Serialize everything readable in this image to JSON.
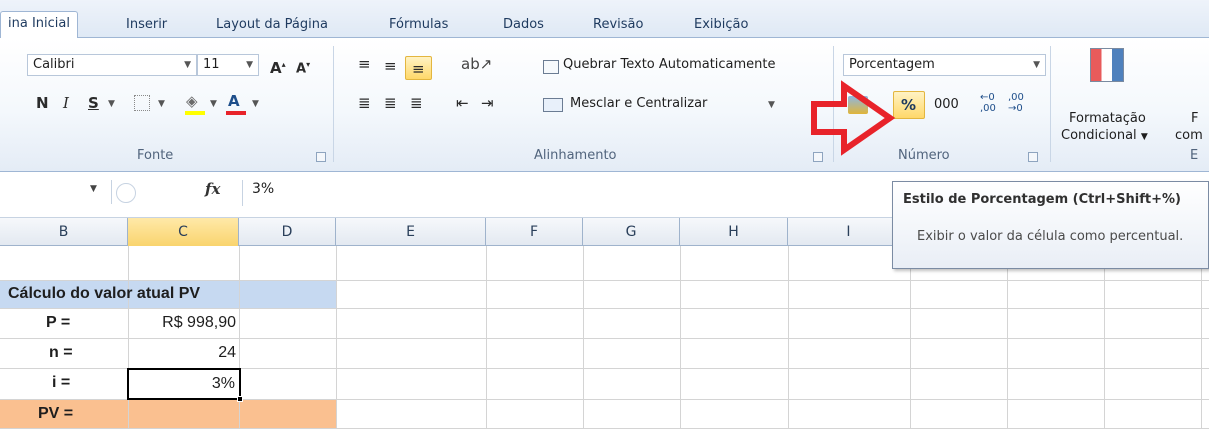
{
  "tabs": [
    "ina Inicial",
    "Inserir",
    "Layout da Página",
    "Fórmulas",
    "Dados",
    "Revisão",
    "Exibição"
  ],
  "font": {
    "name": "Calibri",
    "size": "11",
    "group_label": "Fonte",
    "bold": "N",
    "italic": "I",
    "underline": "S"
  },
  "alignment": {
    "wrap_text": "Quebrar Texto Automaticamente",
    "merge_center": "Mesclar e Centralizar",
    "group_label": "Alinhamento"
  },
  "number": {
    "format": "Porcentagem",
    "percent_symbol": "%",
    "thousands": "000",
    "group_label": "Número",
    "inc_decimal_top": "0",
    "inc_decimal_bottom": ",00",
    "dec_decimal_top": ",00",
    "dec_decimal_bottom": "0"
  },
  "styles": {
    "conditional_line1": "Formatação",
    "conditional_line2": "Condicional",
    "next_line1": "F",
    "next_line2": "com",
    "group_label": "E"
  },
  "formula_bar": {
    "fx": "fx",
    "value": "3%"
  },
  "columns": [
    "B",
    "C",
    "D",
    "E",
    "F",
    "G",
    "H",
    "I"
  ],
  "sheet": {
    "title": "Cálculo do valor atual PV",
    "rows": [
      {
        "label": "P =",
        "value": "R$ 998,90"
      },
      {
        "label": "n =",
        "value": "24"
      },
      {
        "label": "i =",
        "value": "3%"
      },
      {
        "label": "PV =",
        "value": ""
      }
    ]
  },
  "tooltip": {
    "title": "Estilo de Porcentagem (Ctrl+Shift+%)",
    "body": "Exibir o valor da célula como percentual."
  },
  "colors": {
    "accent_arrow": "#e8232a",
    "title_fill": "#c6d9f1",
    "pv_fill": "#fac090",
    "highlight": "#ffd86a"
  }
}
